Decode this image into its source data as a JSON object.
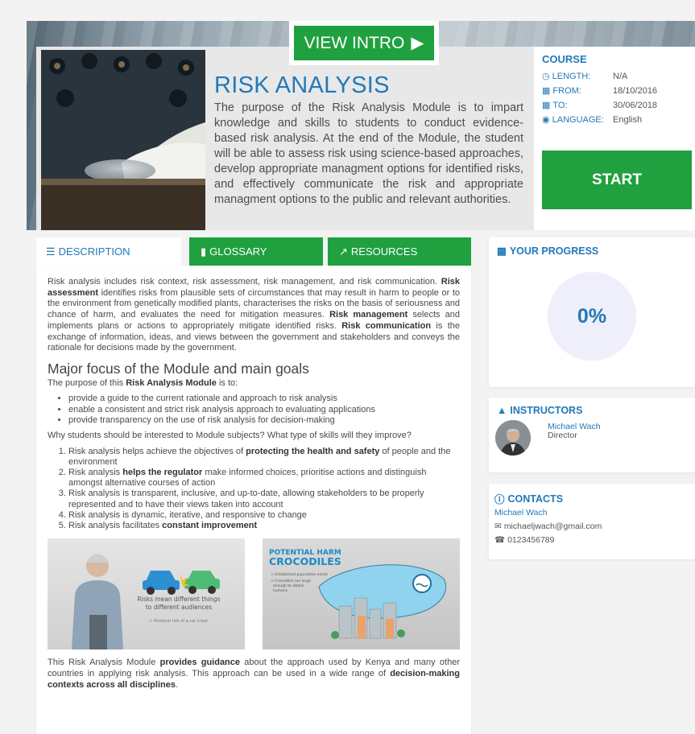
{
  "hero": {
    "intro_button": "VIEW INTRO",
    "title": "RISK ANALYSIS",
    "description": "The purpose of the Risk Analysis Module is to impart knowledge and skills to students to conduct evidence-based risk analysis. At the end of the Module, the student will be able to assess risk using science-based approaches, develop appropriate managment options for identified risks, and effectively communicate the risk and appropriate managment options to the public and relevant authorities."
  },
  "course": {
    "heading": "COURSE",
    "length_label": "LENGTH:",
    "length_value": "N/A",
    "from_label": "FROM:",
    "from_value": "18/10/2016",
    "to_label": "TO:",
    "to_value": "30/06/2018",
    "language_label": "LANGUAGE:",
    "language_value": "English",
    "start_button": "START"
  },
  "tabs": {
    "description": "DESCRIPTION",
    "glossary": "GLOSSARY",
    "resources": "RESOURCES"
  },
  "main": {
    "intro_parts": [
      "Risk analysis includes risk context, risk assessment, risk management, and risk communication. ",
      "Risk assessment",
      " identifies risks from plausible sets of circumstances that may result in harm to people or to the environment from genetically modified plants, characterises the risks on the basis of seriousness and chance of harm, and evaluates the need for mitigation measures. ",
      "Risk management",
      " selects and implements plans or actions to appropriately mitigate identified risks. ",
      "Risk communication",
      " is the exchange of information, ideas, and views between the government and stakeholders and conveys the rationale for decisions made by the government."
    ],
    "heading": "Major focus of the Module and main goals",
    "purpose_pre": "The purpose of this ",
    "purpose_bold": "Risk Analysis Module",
    "purpose_post": " is to:",
    "bullets": [
      "provide a guide to the current rationale and approach to risk analysis",
      "enable a consistent and strict risk analysis approach to evaluating applications",
      "provide transparency on the use of risk analysis for decision-making"
    ],
    "why": "Why students should be interested to Module subjects? What type of skills will they improve?",
    "ol1_pre": "Risk analysis helps achieve the objectives of ",
    "ol1_bold": "protecting the health and safety",
    "ol1_post": " of people and the environment",
    "ol2_pre": "Risk analysis ",
    "ol2_bold": "helps the regulator",
    "ol2_post": " make informed choices, prioritise actions and distinguish amongst alternative courses of action",
    "ol3": "Risk analysis is transparent, inclusive, and up-to-date, allowing stakeholders to be properly represented and to have their views taken into account",
    "ol4": "Risk analysis is dynamic, iterative, and responsive to change",
    "ol5_pre": "Risk analysis facilitates ",
    "ol5_bold": "constant improvement",
    "video1": {
      "caption1": "Risks mean different things",
      "caption2": "to different audiences",
      "sub": "> Personal risk of a car crash"
    },
    "video2": {
      "title1": "POTENTIAL HARM",
      "title2": "CROCODILES",
      "b1": "> Established population exists",
      "b2": "> Crocodiles are large",
      "b3": "enough to attack",
      "b4": "humans"
    },
    "outro_pre": "This Risk Analysis Module ",
    "outro_b1": "provides guidance",
    "outro_mid": " about the approach used by Kenya and many other countries in applying risk analysis. This approach can be used in a wide range of ",
    "outro_b2": "decision-making contexts across all disciplines",
    "outro_end": "."
  },
  "progress": {
    "heading": "YOUR PROGRESS",
    "value": "0%",
    "fraction": 0
  },
  "instructors": {
    "heading": "INSTRUCTORS",
    "name": "Michael Wach",
    "role": "Director"
  },
  "contacts": {
    "heading": "CONTACTS",
    "name": "Michael Wach",
    "email": "michaeljwach@gmail.com",
    "phone": "0123456789"
  },
  "colors": {
    "accent_blue": "#2279b8",
    "green": "#20a03f"
  }
}
